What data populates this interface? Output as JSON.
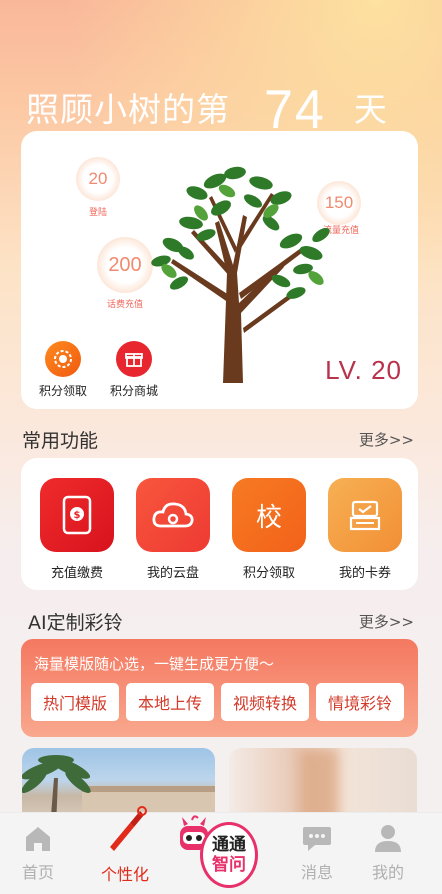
{
  "hero": {
    "title_prefix": "照顾小树的第",
    "days": "74",
    "title_suffix": "天"
  },
  "tree_card": {
    "bubbles": [
      {
        "value": "20",
        "label": "登陆"
      },
      {
        "value": "150",
        "label": "流量充值"
      },
      {
        "value": "200",
        "label": "话费充值"
      }
    ],
    "level": "LV. 20",
    "buttons": [
      {
        "label": "积分领取",
        "icon": "gear-coin-icon"
      },
      {
        "label": "积分商城",
        "icon": "gift-icon"
      }
    ]
  },
  "common": {
    "title": "常用功能",
    "more": "更多>>",
    "items": [
      {
        "label": "充值缴费",
        "icon": "phone-pay-icon",
        "color": "#e8242a"
      },
      {
        "label": "我的云盘",
        "icon": "cloud-icon",
        "color": "#f4493c"
      },
      {
        "label": "积分领取",
        "icon": "school-icon",
        "glyph": "校",
        "color": "#f56a1e"
      },
      {
        "label": "我的卡券",
        "icon": "coupon-icon",
        "color": "#f59a3c"
      }
    ]
  },
  "ai": {
    "title": "AI定制彩铃",
    "more": "更多>>",
    "subtitle": "海量模版随心选，一键生成更方便～",
    "chips": [
      "热门模版",
      "本地上传",
      "视频转换",
      "情境彩铃"
    ]
  },
  "tabbar": {
    "items": [
      {
        "label": "首页",
        "icon": "home-icon"
      },
      {
        "label": "个性化",
        "icon": "brush-icon",
        "active": true
      },
      {
        "label": "消息",
        "icon": "chat-icon"
      },
      {
        "label": "我的",
        "icon": "user-icon"
      }
    ],
    "center": {
      "line1": "通通",
      "line2": "智问"
    }
  }
}
